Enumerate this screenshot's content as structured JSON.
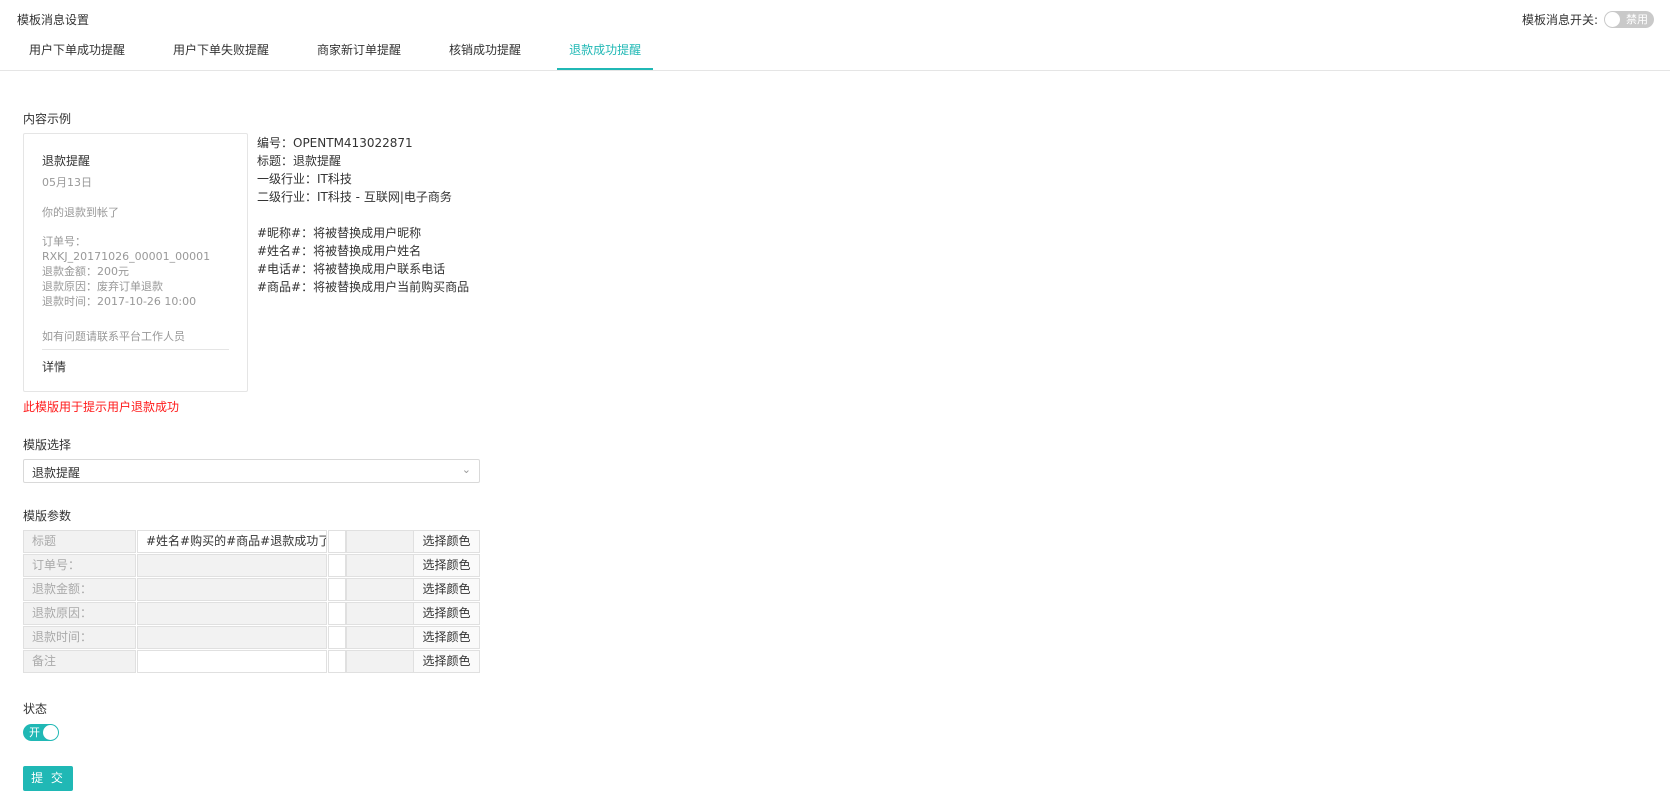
{
  "header": {
    "title": "模板消息设置",
    "switch_label": "模板消息开关:",
    "switch_state": "禁用"
  },
  "tabs": [
    {
      "label": "用户下单成功提醒",
      "active": false
    },
    {
      "label": "用户下单失败提醒",
      "active": false
    },
    {
      "label": "商家新订单提醒",
      "active": false
    },
    {
      "label": "核销成功提醒",
      "active": false
    },
    {
      "label": "退款成功提醒",
      "active": true
    }
  ],
  "sample": {
    "section_label": "内容示例",
    "card": {
      "title": "退款提醒",
      "date": "05月13日",
      "intro": "你的退款到帐了",
      "lines": [
        "订单号：",
        "RXKJ_20171026_00001_00001",
        "退款金额：200元",
        "退款原因：废弃订单退款",
        "退款时间：2017-10-26 10:00"
      ],
      "footer": "如有问题请联系平台工作人员",
      "detail": "详情"
    },
    "info": [
      "编号：OPENTM413022871",
      "标题：退款提醒",
      "一级行业：IT科技",
      "二级行业：IT科技 - 互联网|电子商务"
    ],
    "placeholders": [
      "#昵称#：将被替换成用户昵称",
      "#姓名#：将被替换成用户姓名",
      "#电话#：将被替换成用户联系电话",
      "#商品#：将被替换成用户当前购买商品"
    ],
    "hint": "此模版用于提示用户退款成功"
  },
  "template_select": {
    "label": "模版选择",
    "value": "退款提醒"
  },
  "params": {
    "label": "模版参数",
    "color_button": "选择颜色",
    "rows": [
      {
        "label": "标题",
        "value": "#姓名#购买的#商品#退款成功了"
      },
      {
        "label": "订单号：",
        "value": ""
      },
      {
        "label": "退款金额：",
        "value": ""
      },
      {
        "label": "退款原因：",
        "value": ""
      },
      {
        "label": "退款时间：",
        "value": ""
      },
      {
        "label": "备注",
        "value": ""
      }
    ]
  },
  "status": {
    "label": "状态",
    "toggle_text": "开"
  },
  "submit_label": "提 交",
  "colors": {
    "accent": "#20b8b5",
    "hint": "#ff1a1a"
  }
}
